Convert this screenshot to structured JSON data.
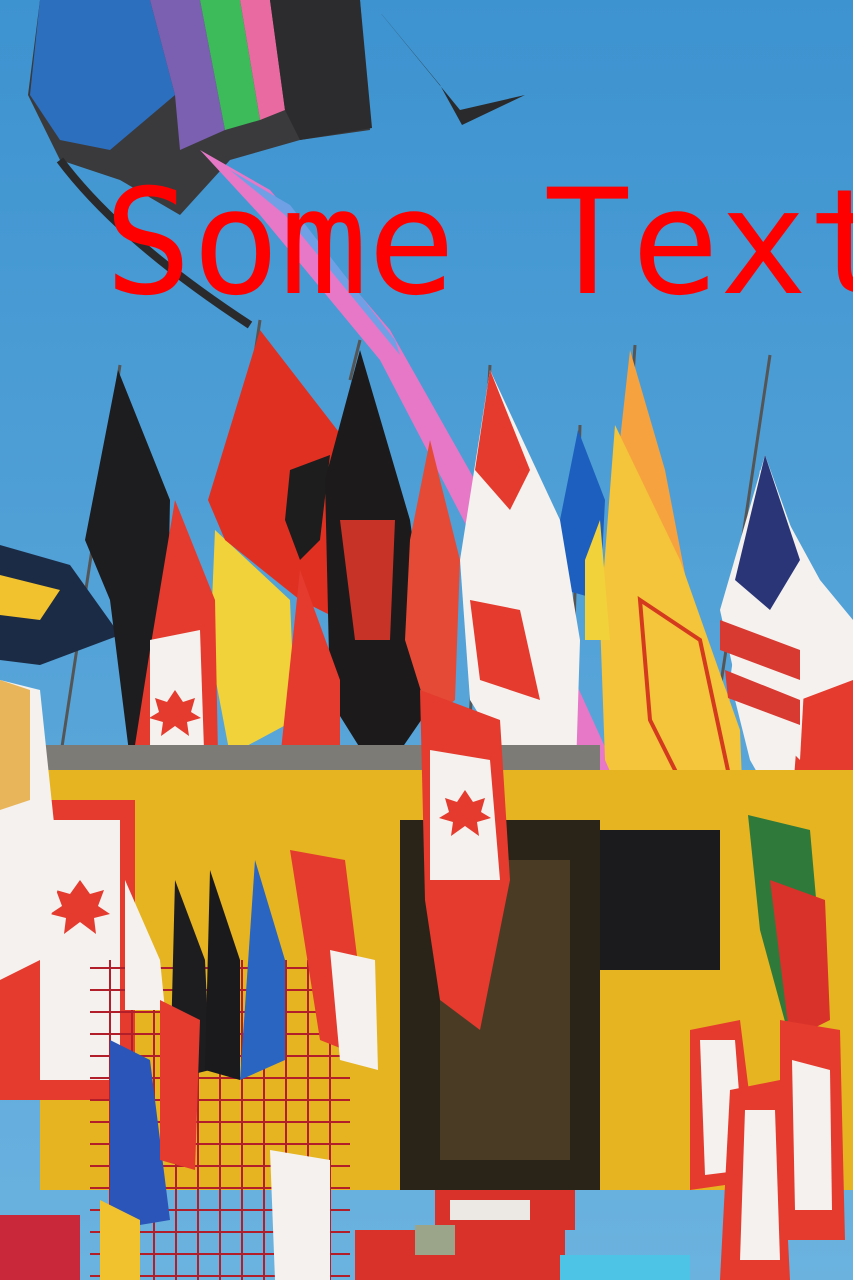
{
  "overlay": {
    "text": "Some Text",
    "color": "#ff0000"
  },
  "scene": {
    "sky_color": "#4fa0d6",
    "van_color": "#e6b420",
    "flag_colors": {
      "canada_red": "#e43b2e",
      "white": "#f4f1ee",
      "albania_red": "#e03022",
      "black": "#1c1a1a",
      "yellow": "#f2d23a",
      "usa_blue": "#2a3578",
      "sash_pink": "#e777c7"
    }
  }
}
